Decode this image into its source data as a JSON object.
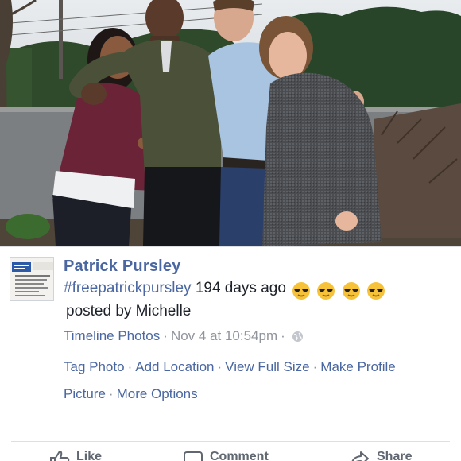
{
  "post": {
    "author": "Patrick Pursley",
    "hashtag": "#freepatrickpursley",
    "message_rest": "194 days ago",
    "message_line2": "posted by Michelle",
    "emoji_icons": [
      "sunglasses-emoji",
      "sunglasses-emoji",
      "sunglasses-emoji",
      "sunglasses-emoji"
    ]
  },
  "meta": {
    "album": "Timeline Photos",
    "date": "Nov 4 at 10:54pm",
    "audience_icon": "globe-icon"
  },
  "actions": {
    "tag_photo": "Tag Photo",
    "add_location": "Add Location",
    "view_full_size": "View Full Size",
    "make_profile_picture": "Make Profile Picture",
    "more_options": "More Options"
  },
  "action_bar": {
    "like": "Like",
    "comment": "Comment",
    "share": "Share"
  },
  "colors": {
    "link_blue": "#4b67a1",
    "meta_gray": "#90949c",
    "text": "#1d2129"
  }
}
